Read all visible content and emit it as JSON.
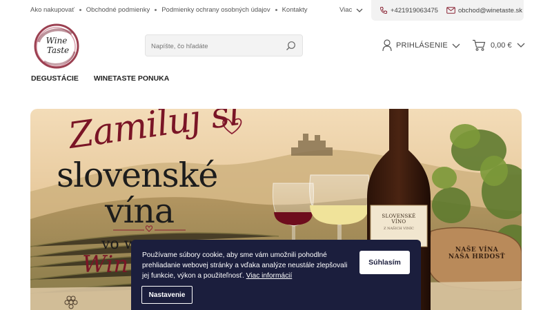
{
  "topbar": {
    "links": [
      "Ako nakupovať",
      "Obchodné podmienky",
      "Podmienky ochrany osobných údajov",
      "Kontakty"
    ],
    "more_label": "Viac",
    "phone": "+421919063475",
    "email": "obchod@winetaste.sk"
  },
  "logo": {
    "line1": "Wine",
    "line2": "Taste"
  },
  "search": {
    "placeholder": "Napíšte, čo hľadáte"
  },
  "account": {
    "login_label": "PRIHLÁSENIE"
  },
  "cart": {
    "total": "0,00 €"
  },
  "nav": [
    "DEGUSTÁCIE",
    "WINETASTE PONUKA"
  ],
  "hero": {
    "title_line1": "Zamiluj si",
    "title_line2": "slovenské",
    "title_line3": "vína",
    "subtitle": "vo w",
    "script": "Win",
    "bottle_label_1": "SLOVENSKÉ VÍNO",
    "bottle_label_2": "Z NAŠICH VINÍC",
    "plaque_1": "NAŠE VÍNA",
    "plaque_2": "NAŠA HRDOSŤ"
  },
  "cookie": {
    "text": "Používame súbory cookie, aby sme vám umožnili pohodlné prehliadanie webovej stránky a vďaka analýze neustále zlepšovali jej funkcie, výkon a použiteľnosť.",
    "link_label": "Viac informácií",
    "accept_label": "Súhlasím",
    "settings_label": "Nastavenie"
  },
  "colors": {
    "brand_wine": "#7a1526",
    "cookie_bg": "#1b1e3d",
    "text_dark": "#222222"
  },
  "icons": [
    "chevron-down-icon",
    "phone-icon",
    "mail-icon",
    "search-icon",
    "user-icon",
    "cart-icon"
  ]
}
